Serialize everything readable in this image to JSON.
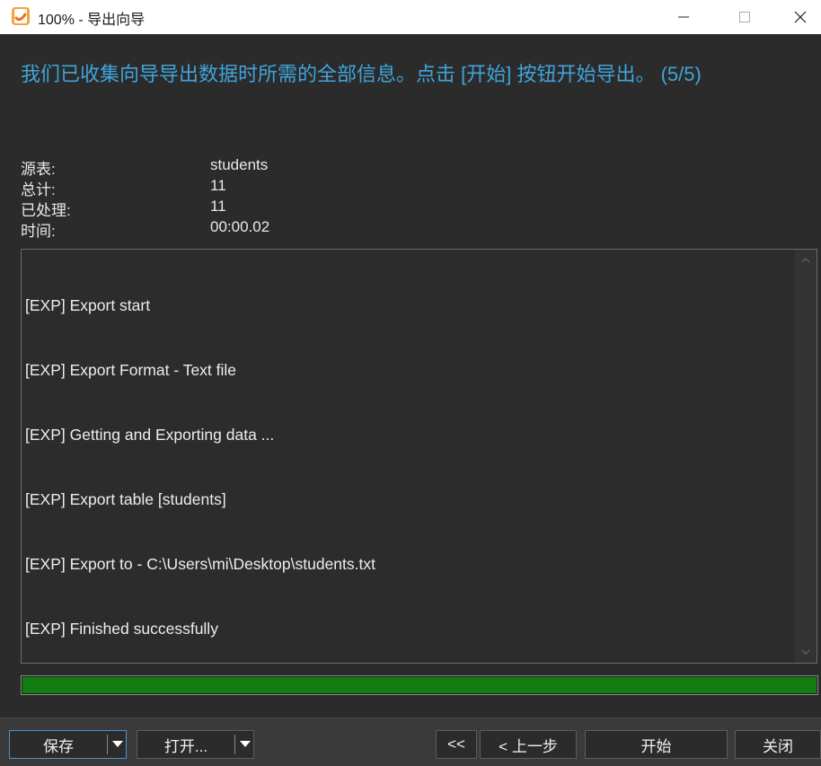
{
  "window": {
    "title": "100% - 导出向导"
  },
  "headline": "我们已收集向导导出数据时所需的全部信息。点击 [开始] 按钮开始导出。 (5/5)",
  "info": [
    {
      "label": "源表:",
      "value": "students"
    },
    {
      "label": "总计:",
      "value": "11"
    },
    {
      "label": "已处理:",
      "value": "11"
    },
    {
      "label": "时间:",
      "value": "00:00.02"
    }
  ],
  "log": [
    "[EXP] Export start",
    "[EXP] Export Format - Text file",
    "[EXP] Getting and Exporting data ...",
    "[EXP] Export table [students]",
    "[EXP] Export to - C:\\Users\\mi\\Desktop\\students.txt",
    "[EXP] Finished successfully"
  ],
  "progress": {
    "percent": 100,
    "color": "#117d11"
  },
  "buttons": {
    "save": "保存",
    "open": "打开...",
    "first": "<<",
    "back": "< 上一步",
    "start": "开始",
    "close": "关闭"
  },
  "colors": {
    "accent": "#3fa4db",
    "background": "#2b2b2b"
  }
}
